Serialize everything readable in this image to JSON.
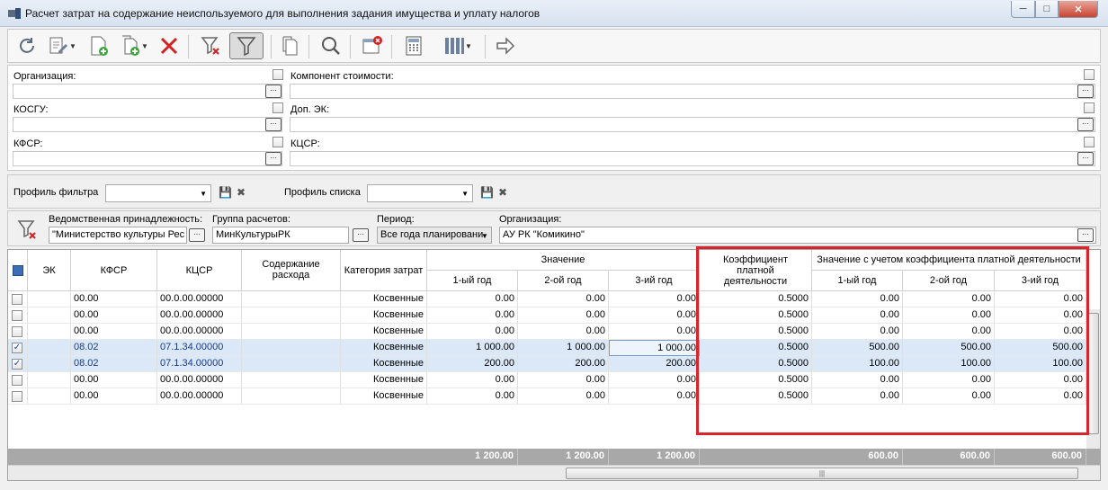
{
  "window": {
    "title": "Расчет затрат на содержание неиспользуемого для выполнения задания имущества и уплату налогов",
    "min": "─",
    "max": "□",
    "close": "✕"
  },
  "filters": {
    "organization_label": "Организация:",
    "component_label": "Компонент стоимости:",
    "kosgu_label": "КОСГУ:",
    "dop_ek_label": "Доп. ЭК:",
    "kfsr_label": "КФСР:",
    "kcsr_label": "КЦСР:",
    "ellipsis": "···"
  },
  "profiles": {
    "filter_profile_label": "Профиль фильтра",
    "list_profile_label": "Профиль списка",
    "arrow": "▼",
    "save_icon": "💾",
    "delete_icon": "✖"
  },
  "params": {
    "dept_label": "Ведомственная принадлежность:",
    "dept_value": "\"Министерство культуры Рес",
    "group_label": "Группа расчетов:",
    "group_value": "МинКультурыРК",
    "period_label": "Период:",
    "period_value": "Все года планировани",
    "org_label": "Организация:",
    "org_value": "АУ РК \"Комикино\""
  },
  "grid": {
    "headers": {
      "ek": "ЭК",
      "kfsr": "КФСР",
      "kcsr": "КЦСР",
      "content": "Содержание расхода",
      "category": "Категория затрат",
      "value_group": "Значение",
      "y1": "1-ый год",
      "y2": "2-ой год",
      "y3": "3-ий год",
      "coef": "Коэффициент платной деятельности",
      "adj_group": "Значение с учетом коэффициента платной деятельности",
      "ay1": "1-ый год",
      "ay2": "2-ой год",
      "ay3": "3-ий год"
    },
    "rows": [
      {
        "checked": false,
        "kfsr": "00.00",
        "kcsr": "00.0.00.00000",
        "category": "Косвенные",
        "y1": "0.00",
        "y2": "0.00",
        "y3": "0.00",
        "coef": "0.5000",
        "ay1": "0.00",
        "ay2": "0.00",
        "ay3": "0.00"
      },
      {
        "checked": false,
        "kfsr": "00.00",
        "kcsr": "00.0.00.00000",
        "category": "Косвенные",
        "y1": "0.00",
        "y2": "0.00",
        "y3": "0.00",
        "coef": "0.5000",
        "ay1": "0.00",
        "ay2": "0.00",
        "ay3": "0.00"
      },
      {
        "checked": false,
        "kfsr": "00.00",
        "kcsr": "00.0.00.00000",
        "category": "Косвенные",
        "y1": "0.00",
        "y2": "0.00",
        "y3": "0.00",
        "coef": "0.5000",
        "ay1": "0.00",
        "ay2": "0.00",
        "ay3": "0.00"
      },
      {
        "checked": true,
        "kfsr": "08.02",
        "kcsr": "07.1.34.00000",
        "category": "Косвенные",
        "y1": "1 000.00",
        "y2": "1 000.00",
        "y3": "1 000.00",
        "coef": "0.5000",
        "ay1": "500.00",
        "ay2": "500.00",
        "ay3": "500.00"
      },
      {
        "checked": true,
        "kfsr": "08.02",
        "kcsr": "07.1.34.00000",
        "category": "Косвенные",
        "y1": "200.00",
        "y2": "200.00",
        "y3": "200.00",
        "coef": "0.5000",
        "ay1": "100.00",
        "ay2": "100.00",
        "ay3": "100.00"
      },
      {
        "checked": false,
        "kfsr": "00.00",
        "kcsr": "00.0.00.00000",
        "category": "Косвенные",
        "y1": "0.00",
        "y2": "0.00",
        "y3": "0.00",
        "coef": "0.5000",
        "ay1": "0.00",
        "ay2": "0.00",
        "ay3": "0.00"
      },
      {
        "checked": false,
        "kfsr": "00.00",
        "kcsr": "00.0.00.00000",
        "category": "Косвенные",
        "y1": "0.00",
        "y2": "0.00",
        "y3": "0.00",
        "coef": "0.5000",
        "ay1": "0.00",
        "ay2": "0.00",
        "ay3": "0.00"
      }
    ],
    "totals": {
      "y1": "1 200.00",
      "y2": "1 200.00",
      "y3": "1 200.00",
      "ay1": "600.00",
      "ay2": "600.00",
      "ay3": "600.00"
    },
    "check_mark": "✓",
    "scroll_grip": "|||"
  },
  "colors": {
    "highlight": "#d6262d",
    "selected_row": "#dbe8f7"
  }
}
